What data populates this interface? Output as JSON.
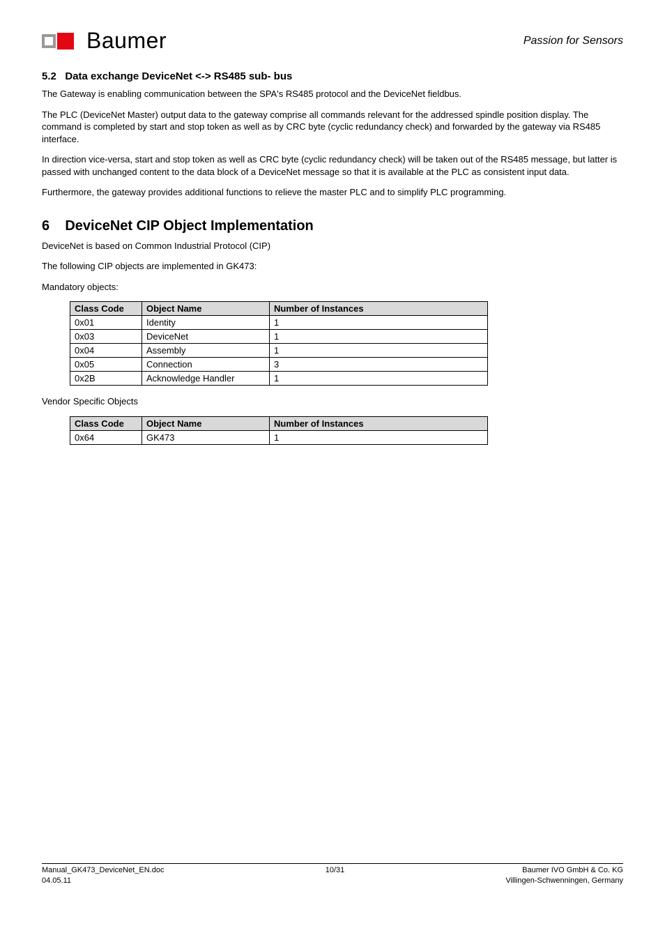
{
  "header": {
    "brand": "Baumer",
    "tagline": "Passion for Sensors"
  },
  "section52": {
    "number": "5.2",
    "title": "Data exchange DeviceNet  <-> RS485 sub- bus",
    "para1": "The Gateway is enabling communication between the SPA's RS485 protocol and the DeviceNet fieldbus.",
    "para2": "The PLC (DeviceNet Master) output data to the gateway comprise all commands relevant for the addressed spindle position display. The command is completed by start and stop token as well as by CRC byte (cyclic redundancy check) and forwarded by the gateway via RS485 interface.",
    "para3": "In direction vice-versa, start and stop token as well as CRC byte (cyclic redundancy check) will be taken out of the RS485 message, but latter is passed with unchanged content to the data block of a DeviceNet message so that it is available at the PLC as consistent input data.",
    "para4": "Furthermore, the gateway provides additional functions to relieve the master PLC and to simplify PLC programming."
  },
  "section6": {
    "number": "6",
    "title": "DeviceNet CIP Object Implementation",
    "intro1": "DeviceNet  is based on Common Industrial Protocol (CIP)",
    "intro2": "The following CIP objects are implemented in GK473:",
    "mandatory_label": "Mandatory objects:",
    "table_headers": {
      "col1": "Class Code",
      "col2": "Object Name",
      "col3": "Number of Instances"
    },
    "mandatory_rows": [
      {
        "code": "0x01",
        "name": "Identity",
        "instances": "1"
      },
      {
        "code": "0x03",
        "name": "DeviceNet",
        "instances": "1"
      },
      {
        "code": "0x04",
        "name": "Assembly",
        "instances": "1"
      },
      {
        "code": "0x05",
        "name": "Connection",
        "instances": "3"
      },
      {
        "code": "0x2B",
        "name": "Acknowledge Handler",
        "instances": "1"
      }
    ],
    "vendor_label": "Vendor Specific Objects",
    "vendor_rows": [
      {
        "code": "0x64",
        "name": "GK473",
        "instances": "1"
      }
    ]
  },
  "footer": {
    "left1": "Manual_GK473_DeviceNet_EN.doc",
    "left2": "04.05.11",
    "center": "10/31",
    "right1": "Baumer IVO GmbH & Co. KG",
    "right2": "Villingen-Schwenningen, Germany"
  }
}
